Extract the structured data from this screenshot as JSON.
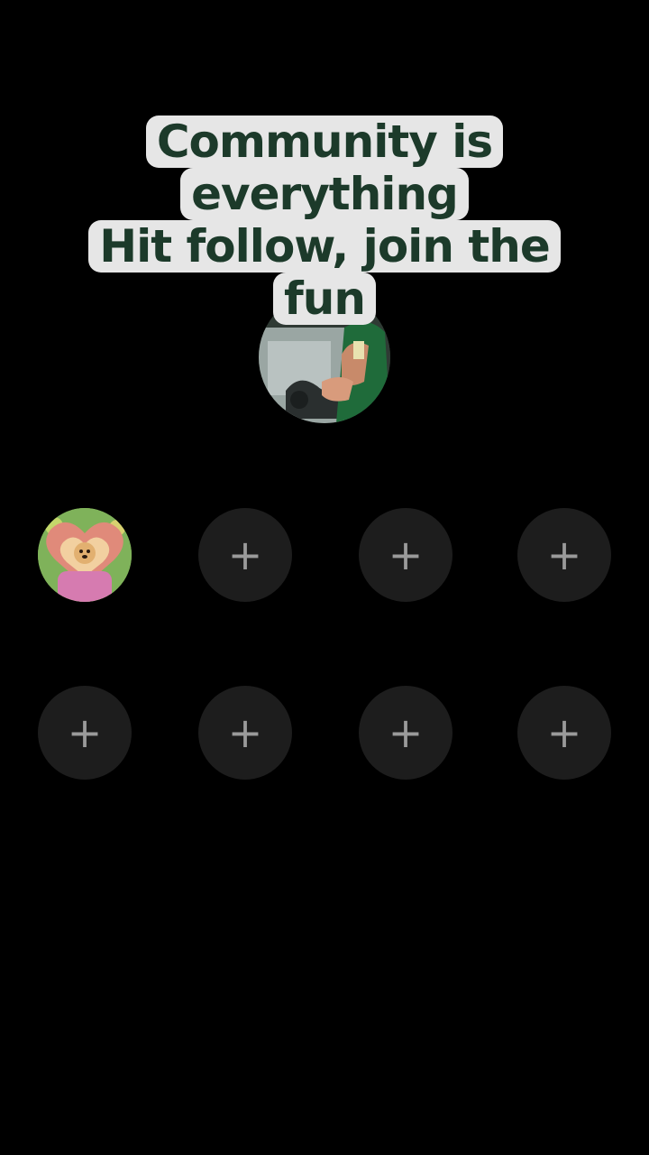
{
  "caption": {
    "lines": [
      "Community is",
      "everything",
      "Hit follow, join the",
      "fun"
    ]
  },
  "slots": {
    "plus_icon": "+",
    "items": [
      {
        "state": "filled",
        "icon": "dog-heart-avatar"
      },
      {
        "state": "empty",
        "icon": "plus-icon"
      },
      {
        "state": "empty",
        "icon": "plus-icon"
      },
      {
        "state": "empty",
        "icon": "plus-icon"
      },
      {
        "state": "empty",
        "icon": "plus-icon"
      },
      {
        "state": "empty",
        "icon": "plus-icon"
      },
      {
        "state": "empty",
        "icon": "plus-icon"
      },
      {
        "state": "empty",
        "icon": "plus-icon"
      }
    ]
  },
  "colors": {
    "background": "#000000",
    "caption_bg": "#e6e6e6",
    "caption_text": "#1c3a2a",
    "slot_bg": "#1d1d1d",
    "plus": "#9a9a9a"
  }
}
